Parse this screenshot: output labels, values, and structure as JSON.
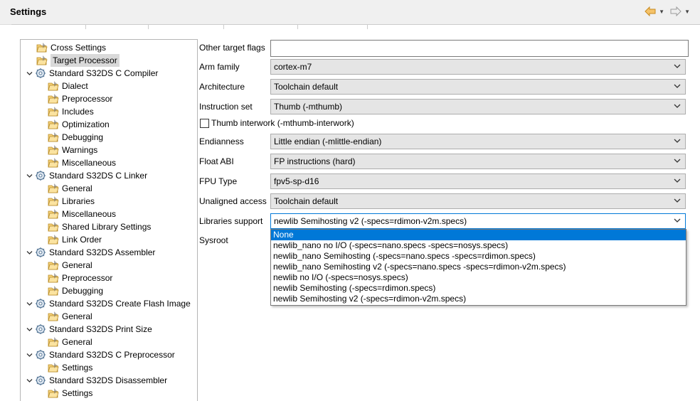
{
  "header": {
    "title": "Settings"
  },
  "tree": {
    "items": [
      {
        "label": "Cross Settings",
        "level": 1,
        "expandable": false,
        "selected": false
      },
      {
        "label": "Target Processor",
        "level": 1,
        "expandable": false,
        "selected": true
      },
      {
        "label": "Standard S32DS C Compiler",
        "level": 0,
        "expandable": true,
        "selected": false
      },
      {
        "label": "Dialect",
        "level": 2,
        "expandable": false,
        "selected": false
      },
      {
        "label": "Preprocessor",
        "level": 2,
        "expandable": false,
        "selected": false
      },
      {
        "label": "Includes",
        "level": 2,
        "expandable": false,
        "selected": false
      },
      {
        "label": "Optimization",
        "level": 2,
        "expandable": false,
        "selected": false
      },
      {
        "label": "Debugging",
        "level": 2,
        "expandable": false,
        "selected": false
      },
      {
        "label": "Warnings",
        "level": 2,
        "expandable": false,
        "selected": false
      },
      {
        "label": "Miscellaneous",
        "level": 2,
        "expandable": false,
        "selected": false
      },
      {
        "label": "Standard S32DS C Linker",
        "level": 0,
        "expandable": true,
        "selected": false
      },
      {
        "label": "General",
        "level": 2,
        "expandable": false,
        "selected": false
      },
      {
        "label": "Libraries",
        "level": 2,
        "expandable": false,
        "selected": false
      },
      {
        "label": "Miscellaneous",
        "level": 2,
        "expandable": false,
        "selected": false
      },
      {
        "label": "Shared Library Settings",
        "level": 2,
        "expandable": false,
        "selected": false
      },
      {
        "label": "Link Order",
        "level": 2,
        "expandable": false,
        "selected": false
      },
      {
        "label": "Standard S32DS Assembler",
        "level": 0,
        "expandable": true,
        "selected": false
      },
      {
        "label": "General",
        "level": 2,
        "expandable": false,
        "selected": false
      },
      {
        "label": "Preprocessor",
        "level": 2,
        "expandable": false,
        "selected": false
      },
      {
        "label": "Debugging",
        "level": 2,
        "expandable": false,
        "selected": false
      },
      {
        "label": "Standard S32DS Create Flash Image",
        "level": 0,
        "expandable": true,
        "selected": false
      },
      {
        "label": "General",
        "level": 2,
        "expandable": false,
        "selected": false
      },
      {
        "label": "Standard S32DS Print Size",
        "level": 0,
        "expandable": true,
        "selected": false
      },
      {
        "label": "General",
        "level": 2,
        "expandable": false,
        "selected": false
      },
      {
        "label": "Standard S32DS C Preprocessor",
        "level": 0,
        "expandable": true,
        "selected": false
      },
      {
        "label": "Settings",
        "level": 2,
        "expandable": false,
        "selected": false
      },
      {
        "label": "Standard S32DS Disassembler",
        "level": 0,
        "expandable": true,
        "selected": false
      },
      {
        "label": "Settings",
        "level": 2,
        "expandable": false,
        "selected": false
      }
    ]
  },
  "form": {
    "other_target_flags": {
      "label": "Other target flags",
      "value": ""
    },
    "arm_family": {
      "label": "Arm family",
      "value": "cortex-m7"
    },
    "architecture": {
      "label": "Architecture",
      "value": "Toolchain default"
    },
    "instruction_set": {
      "label": "Instruction set",
      "value": "Thumb (-mthumb)"
    },
    "thumb_interwork": {
      "label": "Thumb interwork (-mthumb-interwork)",
      "checked": false
    },
    "endianness": {
      "label": "Endianness",
      "value": "Little endian (-mlittle-endian)"
    },
    "float_abi": {
      "label": "Float ABI",
      "value": "FP instructions (hard)"
    },
    "fpu_type": {
      "label": "FPU Type",
      "value": "fpv5-sp-d16"
    },
    "unaligned_access": {
      "label": "Unaligned access",
      "value": "Toolchain default"
    },
    "libraries_support": {
      "label": "Libraries support",
      "value": "newlib Semihosting v2 (-specs=rdimon-v2m.specs)",
      "options": [
        "None",
        "newlib_nano no I/O (-specs=nano.specs -specs=nosys.specs)",
        "newlib_nano Semihosting (-specs=nano.specs -specs=rdimon.specs)",
        "newlib_nano Semihosting v2 (-specs=nano.specs -specs=rdimon-v2m.specs)",
        "newlib no I/O (-specs=nosys.specs)",
        "newlib Semihosting (-specs=rdimon.specs)",
        "newlib Semihosting v2 (-specs=rdimon-v2m.specs)"
      ],
      "highlighted_index": 0
    },
    "sysroot": {
      "label": "Sysroot"
    }
  },
  "colors": {
    "selection": "#0078d7",
    "selected_tree_bg": "#d9d9d9",
    "nav_arrow": "#f0a030"
  }
}
